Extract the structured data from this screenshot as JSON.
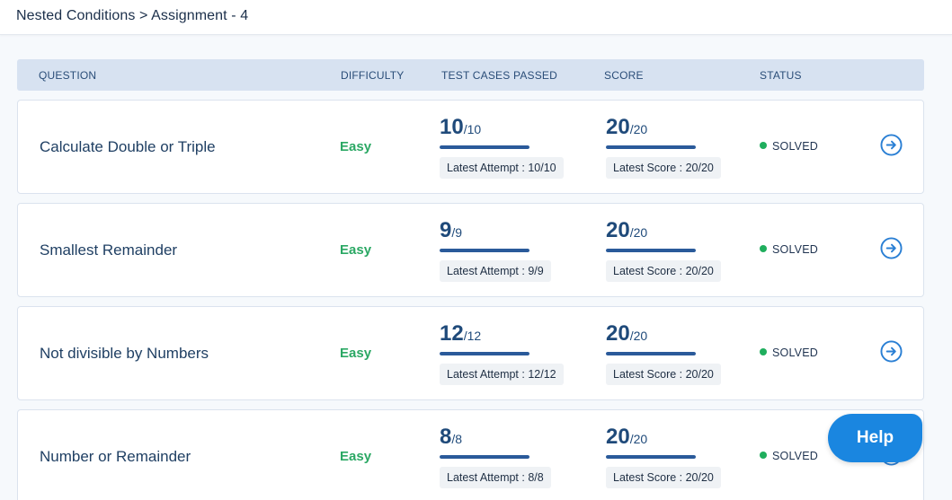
{
  "breadcrumb": "Nested Conditions > Assignment - 4",
  "table": {
    "headers": {
      "question": "QUESTION",
      "difficulty": "DIFFICULTY",
      "test_cases": "TEST CASES PASSED",
      "score": "SCORE",
      "status": "STATUS"
    },
    "rows": [
      {
        "question": "Calculate Double or Triple",
        "difficulty": "Easy",
        "tests_passed": "10",
        "tests_total": "/10",
        "latest_attempt": "Latest Attempt : 10/10",
        "score": "20",
        "score_total": "/20",
        "latest_score": "Latest Score : 20/20",
        "status": "SOLVED"
      },
      {
        "question": "Smallest Remainder",
        "difficulty": "Easy",
        "tests_passed": "9",
        "tests_total": "/9",
        "latest_attempt": "Latest Attempt : 9/9",
        "score": "20",
        "score_total": "/20",
        "latest_score": "Latest Score : 20/20",
        "status": "SOLVED"
      },
      {
        "question": "Not divisible by Numbers",
        "difficulty": "Easy",
        "tests_passed": "12",
        "tests_total": "/12",
        "latest_attempt": "Latest Attempt : 12/12",
        "score": "20",
        "score_total": "/20",
        "latest_score": "Latest Score : 20/20",
        "status": "SOLVED"
      },
      {
        "question": "Number or Remainder",
        "difficulty": "Easy",
        "tests_passed": "8",
        "tests_total": "/8",
        "latest_attempt": "Latest Attempt : 8/8",
        "score": "20",
        "score_total": "/20",
        "latest_score": "Latest Score : 20/20",
        "status": "SOLVED"
      }
    ]
  },
  "help_label": "Help",
  "colors": {
    "accent": "#1a86e0",
    "easy": "#2ba864",
    "solved": "#1fae5d",
    "bar": "#2a5a9a"
  },
  "icons": {
    "row_action": "arrow-right-circle-icon",
    "status": "status-dot-icon"
  }
}
